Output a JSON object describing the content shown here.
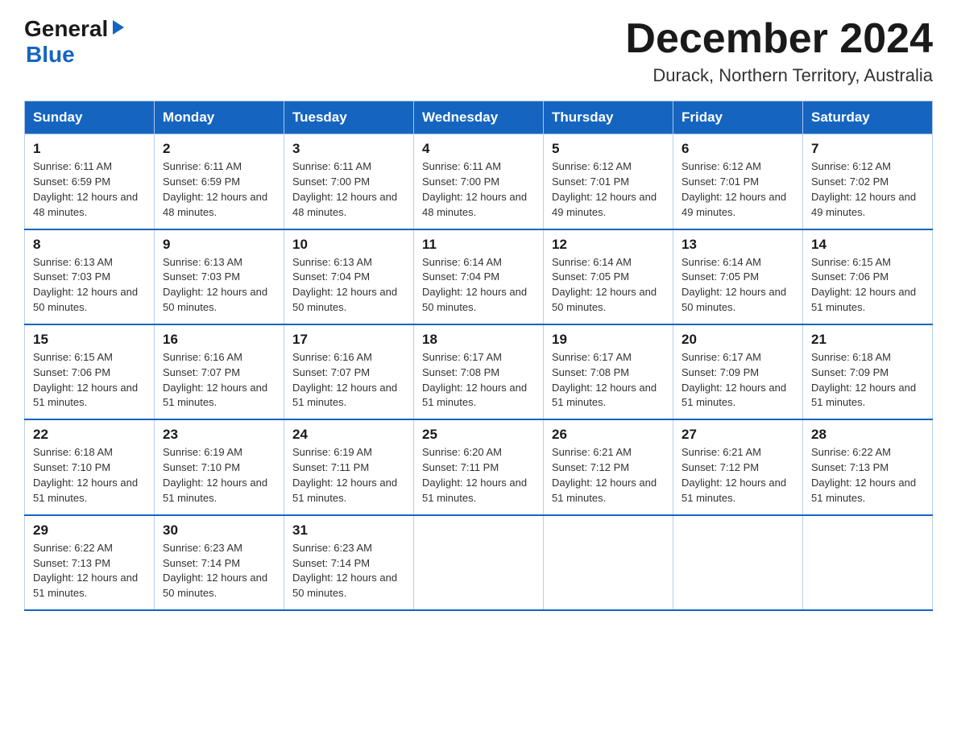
{
  "header": {
    "logo_line1": "General",
    "logo_line2": "Blue",
    "month_title": "December 2024",
    "location": "Durack, Northern Territory, Australia"
  },
  "weekdays": [
    "Sunday",
    "Monday",
    "Tuesday",
    "Wednesday",
    "Thursday",
    "Friday",
    "Saturday"
  ],
  "weeks": [
    [
      {
        "day": "1",
        "sunrise": "6:11 AM",
        "sunset": "6:59 PM",
        "daylight": "12 hours and 48 minutes."
      },
      {
        "day": "2",
        "sunrise": "6:11 AM",
        "sunset": "6:59 PM",
        "daylight": "12 hours and 48 minutes."
      },
      {
        "day": "3",
        "sunrise": "6:11 AM",
        "sunset": "7:00 PM",
        "daylight": "12 hours and 48 minutes."
      },
      {
        "day": "4",
        "sunrise": "6:11 AM",
        "sunset": "7:00 PM",
        "daylight": "12 hours and 48 minutes."
      },
      {
        "day": "5",
        "sunrise": "6:12 AM",
        "sunset": "7:01 PM",
        "daylight": "12 hours and 49 minutes."
      },
      {
        "day": "6",
        "sunrise": "6:12 AM",
        "sunset": "7:01 PM",
        "daylight": "12 hours and 49 minutes."
      },
      {
        "day": "7",
        "sunrise": "6:12 AM",
        "sunset": "7:02 PM",
        "daylight": "12 hours and 49 minutes."
      }
    ],
    [
      {
        "day": "8",
        "sunrise": "6:13 AM",
        "sunset": "7:03 PM",
        "daylight": "12 hours and 50 minutes."
      },
      {
        "day": "9",
        "sunrise": "6:13 AM",
        "sunset": "7:03 PM",
        "daylight": "12 hours and 50 minutes."
      },
      {
        "day": "10",
        "sunrise": "6:13 AM",
        "sunset": "7:04 PM",
        "daylight": "12 hours and 50 minutes."
      },
      {
        "day": "11",
        "sunrise": "6:14 AM",
        "sunset": "7:04 PM",
        "daylight": "12 hours and 50 minutes."
      },
      {
        "day": "12",
        "sunrise": "6:14 AM",
        "sunset": "7:05 PM",
        "daylight": "12 hours and 50 minutes."
      },
      {
        "day": "13",
        "sunrise": "6:14 AM",
        "sunset": "7:05 PM",
        "daylight": "12 hours and 50 minutes."
      },
      {
        "day": "14",
        "sunrise": "6:15 AM",
        "sunset": "7:06 PM",
        "daylight": "12 hours and 51 minutes."
      }
    ],
    [
      {
        "day": "15",
        "sunrise": "6:15 AM",
        "sunset": "7:06 PM",
        "daylight": "12 hours and 51 minutes."
      },
      {
        "day": "16",
        "sunrise": "6:16 AM",
        "sunset": "7:07 PM",
        "daylight": "12 hours and 51 minutes."
      },
      {
        "day": "17",
        "sunrise": "6:16 AM",
        "sunset": "7:07 PM",
        "daylight": "12 hours and 51 minutes."
      },
      {
        "day": "18",
        "sunrise": "6:17 AM",
        "sunset": "7:08 PM",
        "daylight": "12 hours and 51 minutes."
      },
      {
        "day": "19",
        "sunrise": "6:17 AM",
        "sunset": "7:08 PM",
        "daylight": "12 hours and 51 minutes."
      },
      {
        "day": "20",
        "sunrise": "6:17 AM",
        "sunset": "7:09 PM",
        "daylight": "12 hours and 51 minutes."
      },
      {
        "day": "21",
        "sunrise": "6:18 AM",
        "sunset": "7:09 PM",
        "daylight": "12 hours and 51 minutes."
      }
    ],
    [
      {
        "day": "22",
        "sunrise": "6:18 AM",
        "sunset": "7:10 PM",
        "daylight": "12 hours and 51 minutes."
      },
      {
        "day": "23",
        "sunrise": "6:19 AM",
        "sunset": "7:10 PM",
        "daylight": "12 hours and 51 minutes."
      },
      {
        "day": "24",
        "sunrise": "6:19 AM",
        "sunset": "7:11 PM",
        "daylight": "12 hours and 51 minutes."
      },
      {
        "day": "25",
        "sunrise": "6:20 AM",
        "sunset": "7:11 PM",
        "daylight": "12 hours and 51 minutes."
      },
      {
        "day": "26",
        "sunrise": "6:21 AM",
        "sunset": "7:12 PM",
        "daylight": "12 hours and 51 minutes."
      },
      {
        "day": "27",
        "sunrise": "6:21 AM",
        "sunset": "7:12 PM",
        "daylight": "12 hours and 51 minutes."
      },
      {
        "day": "28",
        "sunrise": "6:22 AM",
        "sunset": "7:13 PM",
        "daylight": "12 hours and 51 minutes."
      }
    ],
    [
      {
        "day": "29",
        "sunrise": "6:22 AM",
        "sunset": "7:13 PM",
        "daylight": "12 hours and 51 minutes."
      },
      {
        "day": "30",
        "sunrise": "6:23 AM",
        "sunset": "7:14 PM",
        "daylight": "12 hours and 50 minutes."
      },
      {
        "day": "31",
        "sunrise": "6:23 AM",
        "sunset": "7:14 PM",
        "daylight": "12 hours and 50 minutes."
      },
      null,
      null,
      null,
      null
    ]
  ]
}
